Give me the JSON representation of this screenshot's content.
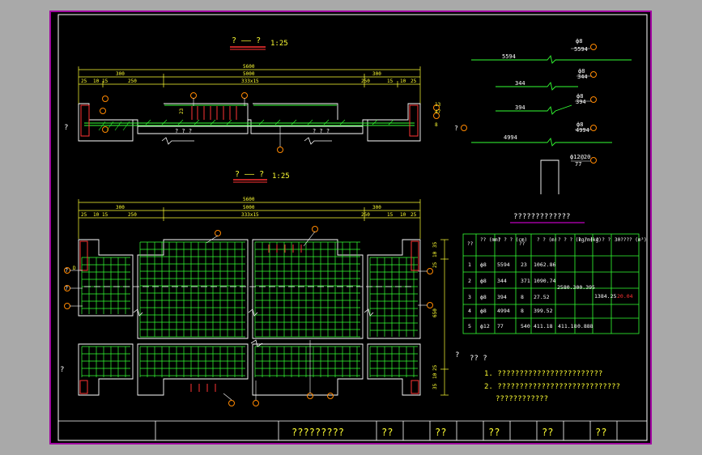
{
  "colors": {
    "background": "#000000",
    "frame": "#a9a9a9",
    "border": "#a000a0",
    "dimension": "#ffff33",
    "rebar": "#33ff33",
    "outline": "#ffffff",
    "marker": "#ff3333",
    "callout": "#ff8800"
  },
  "plan_title": "? —— ?",
  "plan_scale": "1:25",
  "section_title": "? —— ?",
  "section_scale": "1:25",
  "dims": {
    "total": "5600",
    "inner": "5000",
    "left": "300",
    "right": "300",
    "sub_left": [
      "25",
      "10",
      "15"
    ],
    "sub_right": [
      "15",
      "10",
      "25"
    ],
    "seg_left": "250",
    "seg_right": "250",
    "spacing": "333x15",
    "spacing2": "333x15",
    "height_a": "13",
    "height_b": "47",
    "height_c": "8",
    "rebar_h": "23",
    "v_dims": [
      "35",
      "10",
      "25",
      "650",
      "25",
      "10",
      "35"
    ]
  },
  "plan_labels": {
    "left_mark": "?",
    "bottom_mid": "? ? ?",
    "bottom_mid2": "? ? ?",
    "right_mark": "?",
    "callout_1": "1"
  },
  "section_labels": {
    "left_mark": "?",
    "label_d": "D",
    "tag_a": "?",
    "tag_b": "?"
  },
  "bars": [
    {
      "id": "1",
      "label": "5594",
      "spec": "ф8",
      "len": "5594"
    },
    {
      "id": "2",
      "label": "344",
      "spec": "ф8",
      "len": "344"
    },
    {
      "id": "3",
      "label": "394",
      "spec": "ф8",
      "len": "394"
    },
    {
      "id": "4",
      "label": "4994",
      "spec": "ф8",
      "len": "4994"
    },
    {
      "id": "5",
      "label": "77",
      "spec": "ф12",
      "len": "77"
    }
  ],
  "stirrup_label": "ф12@20",
  "stirrup_len": "77",
  "table": {
    "title": "?????????????",
    "headers": [
      "??",
      "??\n(mm)",
      "? ? ?\n(cm)",
      "??",
      "? ?\n(m)",
      "? ? ?\n(kg/m)",
      "? ?\n(kg)",
      "? ? ?",
      "30????\n(m³)"
    ],
    "rows": [
      [
        "1",
        "ф8",
        "5594",
        "23",
        "1062.86"
      ],
      [
        "2",
        "ф8",
        "344",
        "371",
        "1090.74"
      ],
      [
        "3",
        "ф8",
        "394",
        "8",
        "27.52"
      ],
      [
        "4",
        "ф8",
        "4994",
        "8",
        "399.52"
      ],
      [
        "5",
        "ф12",
        "77",
        "540",
        "411.18",
        "411.18",
        "0.888"
      ]
    ],
    "merged_a": "2580.300.395",
    "merged_b": "1384.25",
    "merged_c": "20.04"
  },
  "notes": {
    "title": "?? ?",
    "lead": "?",
    "items": [
      "1. ????????????????????????",
      "2. ????????????????????????????",
      "????????????"
    ]
  },
  "title_block": {
    "name": "?????????",
    "cells": [
      "??",
      "??",
      "??",
      "??",
      "??"
    ]
  }
}
